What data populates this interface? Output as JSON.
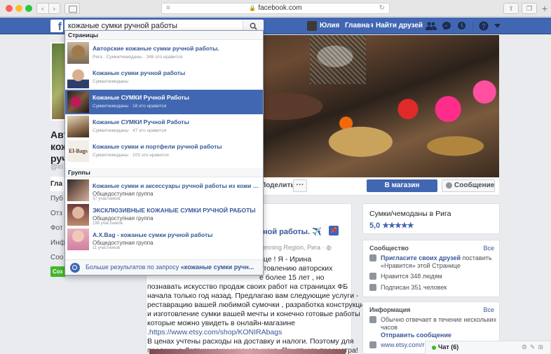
{
  "browser": {
    "url": "facebook.com",
    "traffic_lights": {
      "close": "#fc5f57",
      "minimize": "#fdbc2e",
      "maximize": "#28c840"
    }
  },
  "fb_header": {
    "search_value": "кожаные сумки ручной работы",
    "user_name": "Юлия",
    "nav_home": "Главная",
    "nav_find_friends": "Найти друзей",
    "brand_color": "#4267b2"
  },
  "page": {
    "name_partial_lines": [
      "Авт",
      "кож",
      "руч"
    ],
    "handle_partial": "@iri",
    "left_nav": [
      "Гла",
      "Пуб",
      "Отз",
      "Фот",
      "Инф",
      "Соо"
    ],
    "create_button": "Соз",
    "share_button": "Поделиться",
    "more_button": "···",
    "shop_button": "В магазин",
    "message_button": "Сообщение"
  },
  "post": {
    "title_partial": "ной работы. ✈️",
    "meta_partial": "enning Region, Рига · ",
    "lines": [
      "ице ! Я - Ирина",
      "отовлению авторских",
      "е более 15 лет , но",
      "познавать искусство продаж своих работ на страницах ФБ",
      "начала только год назад. Предлагаю вам следующие услуги -",
      "реставрацию вашей любимой сумочки , разработка конструкции",
      "и изготовление сумки вашей мечты и конечно готовые работы ,",
      "которые можно увидеть в онлайн-магазине",
      "https://www.etsy.com/shop/KONIRAbags",
      "В ценах учтены расходы на доставку и налоги. Поэтому для",
      "продажи в Латвии цены намного ниже. Приятного просмотра!"
    ],
    "link_prefix": "."
  },
  "right_col": {
    "category": "Сумки/чемоданы в Рига",
    "rating": "5,0",
    "stars": "★★★★★",
    "community": {
      "heading": "Сообщество",
      "all": "Все",
      "invite_link": "Пригласите своих друзей",
      "invite_rest": " поставить «Нравится» этой Странице",
      "likes": "Нравится 348 людям",
      "follows": "Подписан 351 человек"
    },
    "info": {
      "heading": "Информация",
      "all": "Все",
      "response": "Обычно отвечает в течение нескольких часов",
      "send_message": "Отправить сообщение",
      "website": "www.etsy.com/ru"
    }
  },
  "chat": {
    "label": "Чат (6)",
    "online_color": "#42b72a"
  },
  "dropdown": {
    "pages_heading": "Страницы",
    "groups_heading": "Группы",
    "pages": [
      {
        "title": "Авторские кожаные сумки ручной работы.",
        "sub": "Рига · Сумки/чемоданы · 348 это нравится",
        "thumb": "bags-photo"
      },
      {
        "title": "Кожаные сумки ручной работы",
        "sub": "Сумки/чемоданы",
        "thumb": "man-portrait"
      },
      {
        "title": "Кожаные СУМКИ Ручной Работы",
        "sub": "Сумки/чемоданы · 18 это нравится",
        "thumb": "bag-photo"
      },
      {
        "title": "Кожаные СУМКИ Ручной Работы",
        "sub": "Сумки/чемоданы · 47 это нравится",
        "thumb": "bags-photo-2"
      },
      {
        "title": "Кожаные сумки и портфели ручной работы",
        "sub": "Сумки/чемоданы · 103 это нравится",
        "thumb": "El-Bags"
      }
    ],
    "groups": [
      {
        "title": "Кожаные сумки и аксессуары ручной работы из кожи (h...",
        "type": "Общедоступная группа",
        "members": "37 участников"
      },
      {
        "title": "ЭКСКЛЮЗИВНЫЕ КОЖАНЫЕ СУМКИ РУЧНОЙ РАБОТЫ",
        "type": "Общедоступная группа",
        "members": "198 участников"
      },
      {
        "title": "A.X.Bag - кожаные сумки ручной работы",
        "type": "Общедоступная группа",
        "members": "11 участников"
      }
    ],
    "more_results_prefix": "Больше результатов по запросу ",
    "more_results_query": "«кожаные сумки ручн..."
  }
}
